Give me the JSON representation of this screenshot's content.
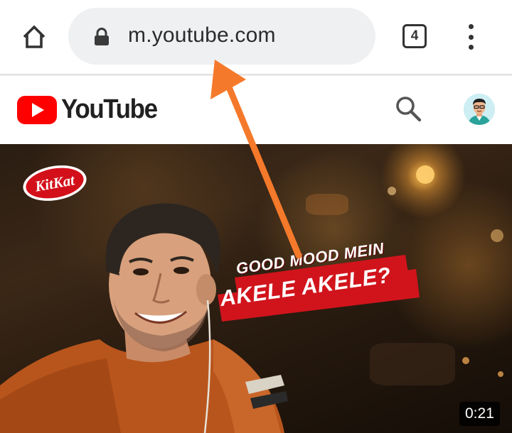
{
  "browser": {
    "url": "m.youtube.com",
    "tab_count": "4",
    "icons": {
      "home": "home-icon",
      "lock": "lock-icon",
      "menu": "more-vert-icon"
    }
  },
  "youtube": {
    "logo_text": "YouTube",
    "icons": {
      "search": "search-icon",
      "avatar": "account-avatar"
    },
    "brand_color": "#ff0000"
  },
  "video": {
    "brand_logo_text": "KitKat",
    "headline_line1": "GOOD MOOD MEIN",
    "headline_line2": "AKELE AKELE?",
    "duration": "0:21"
  },
  "annotation": {
    "arrow_color": "#f5792a"
  }
}
